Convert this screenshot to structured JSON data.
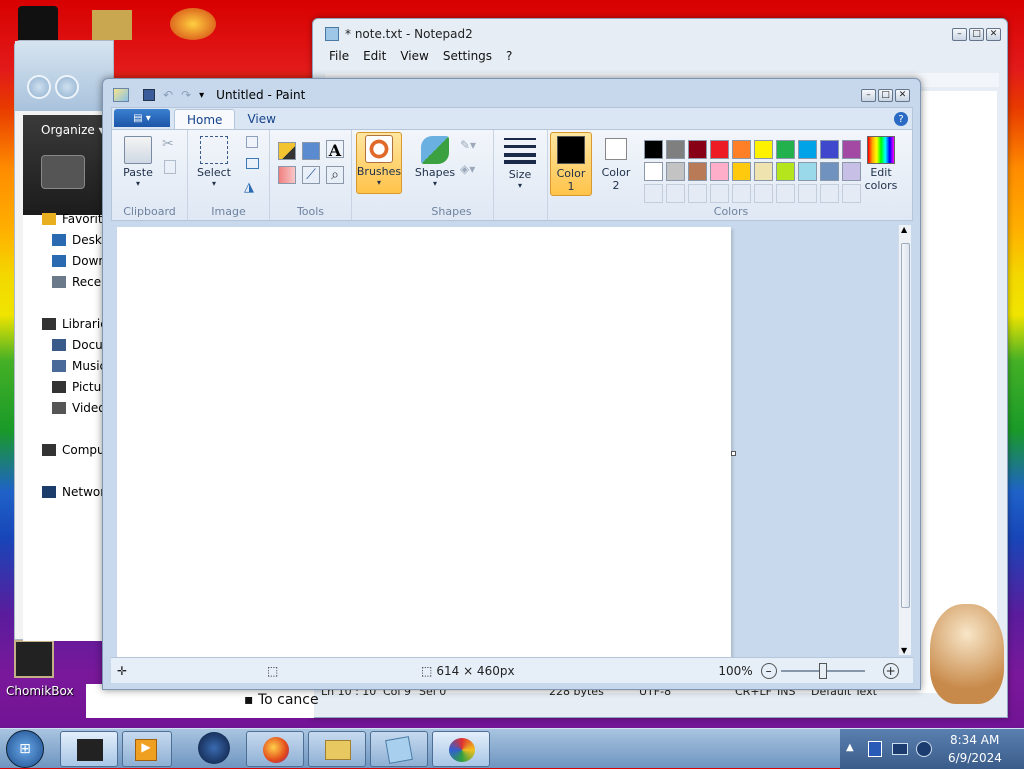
{
  "desktop": {
    "icons": [
      {
        "label": "ChomikBox"
      }
    ]
  },
  "notepad": {
    "title": "* note.txt - Notepad2",
    "menu": [
      "File",
      "Edit",
      "View",
      "Settings",
      "?"
    ],
    "status": {
      "position": "Ln 10 : 10",
      "col": "Col 9",
      "sel": "Sel 0",
      "size": "228 bytes",
      "encoding": "UTF-8",
      "eol": "CR+LF",
      "mode": "INS",
      "scheme": "Default Text"
    },
    "behind_text": "To cance"
  },
  "explorer": {
    "organize_label": "Organize",
    "nav": [
      {
        "label": "Favorites",
        "icon": "star-icon"
      },
      {
        "label": "Desktop",
        "icon": "desktop-icon"
      },
      {
        "label": "Downloads",
        "icon": "downloads-icon"
      },
      {
        "label": "Recent",
        "icon": "recent-icon"
      },
      {
        "label": "Libraries",
        "icon": "library-icon"
      },
      {
        "label": "Documents",
        "icon": "documents-icon"
      },
      {
        "label": "Music",
        "icon": "music-icon"
      },
      {
        "label": "Pictures",
        "icon": "pictures-icon"
      },
      {
        "label": "Videos",
        "icon": "videos-icon"
      },
      {
        "label": "Computer",
        "icon": "computer-icon"
      },
      {
        "label": "Network",
        "icon": "network-icon"
      }
    ]
  },
  "paint": {
    "title": "Untitled - Paint",
    "tabs": [
      "Home",
      "View"
    ],
    "groups": {
      "clipboard": "Clipboard",
      "image": "Image",
      "tools": "Tools",
      "shapes": "Shapes",
      "colors": "Colors"
    },
    "buttons": {
      "paste": "Paste",
      "select": "Select",
      "brushes": "Brushes",
      "shapes": "Shapes",
      "size": "Size",
      "color1": "Color 1",
      "color2": "Color 2",
      "edit_colors": "Edit colors"
    },
    "palette_row1": [
      "#000000",
      "#7f7f7f",
      "#880015",
      "#ed1c24",
      "#ff7f27",
      "#fff200",
      "#22b14c",
      "#00a2e8",
      "#3f48cc",
      "#a349a4"
    ],
    "palette_row2": [
      "#ffffff",
      "#c3c3c3",
      "#b97a57",
      "#ffaec9",
      "#ffc90e",
      "#efe4b0",
      "#b5e61d",
      "#99d9ea",
      "#7092be",
      "#c8bfe7"
    ],
    "color1": "#000000",
    "color2": "#ffffff",
    "status": {
      "dimensions": "614 × 460px",
      "zoom": "100%"
    }
  },
  "taskbar": {
    "time": "8:34 AM",
    "date": "6/9/2024"
  }
}
